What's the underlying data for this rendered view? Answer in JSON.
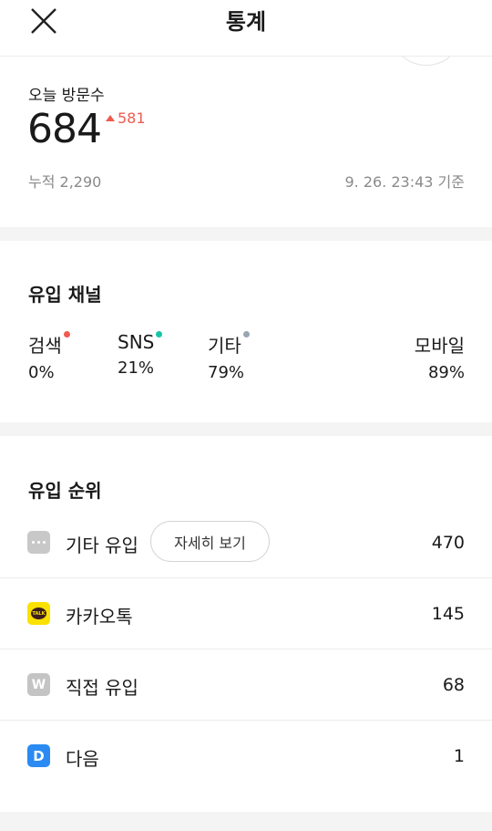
{
  "header": {
    "title": "통계",
    "close_icon": "close-icon"
  },
  "today": {
    "label": "오늘 방문수",
    "count": "684",
    "delta": "581",
    "cumulative": "누적 2,290",
    "timestamp": "9. 26. 23:43 기준"
  },
  "channels": {
    "title": "유입 채널",
    "items": [
      {
        "name": "검색",
        "percent": "0%",
        "dot_color": "#f05a4f"
      },
      {
        "name": "SNS",
        "percent": "21%",
        "dot_color": "#17c4a7"
      },
      {
        "name": "기타",
        "percent": "79%",
        "dot_color": "#9aa5b4"
      },
      {
        "name": "모바일",
        "percent": "89%"
      }
    ]
  },
  "ranking": {
    "title": "유입 순위",
    "detail_button": "자세히 보기",
    "items": [
      {
        "label": "기타 유입",
        "value": "470",
        "icon": "more-dots-icon"
      },
      {
        "label": "카카오톡",
        "value": "145",
        "icon": "kakaotalk-icon",
        "icon_text": "TALK"
      },
      {
        "label": "직접 유입",
        "value": "68",
        "icon": "direct-w-icon",
        "icon_text": "W"
      },
      {
        "label": "다음",
        "value": "1",
        "icon": "daum-d-icon",
        "icon_text": "D"
      }
    ]
  },
  "colors": {
    "accent_red": "#f05a4f",
    "accent_teal": "#17c4a7",
    "kakao_yellow": "#fae100",
    "daum_blue": "#2b8bf2"
  }
}
